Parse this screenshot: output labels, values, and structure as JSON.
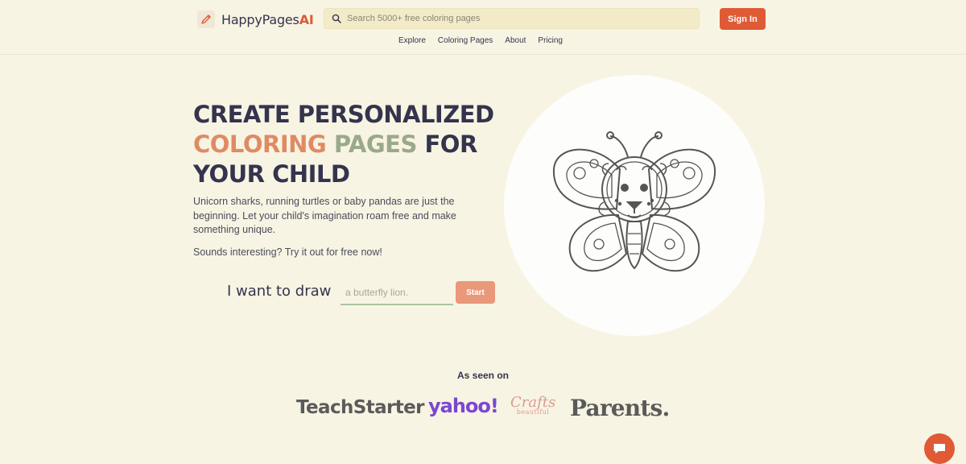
{
  "header": {
    "logo": {
      "text": "HappyPages",
      "accent": "AI",
      "icon": "pencil-icon"
    },
    "search": {
      "placeholder": "Search 5000+ free coloring pages"
    },
    "signin_label": "Sign In",
    "nav": [
      "Explore",
      "Coloring Pages",
      "About",
      "Pricing"
    ]
  },
  "hero": {
    "title_line1": "Create personalized",
    "title_word_colored1": "coloring",
    "title_word_colored2": "pages",
    "title_word_for": "for",
    "title_line3": "your child",
    "lead": "Unicorn sharks, running turtles or baby pandas are just the beginning. Let your child's imagination roam free and make something unique.",
    "sub": "Sounds interesting? Try it out for free now!",
    "draw_label": "I want to draw",
    "draw_placeholder": "a butterfly lion.",
    "start_label": "Start",
    "image": "butterfly-lion-coloring-page"
  },
  "seen_on": {
    "heading": "As seen on",
    "brands": [
      "TeachStarter",
      "yahoo!",
      "Crafts",
      "beautiful",
      "Parents."
    ]
  },
  "chat": {
    "icon": "chat-bubble-icon"
  },
  "colors": {
    "background": "#f8f4e3",
    "accent": "#df5a35",
    "start_button": "#ea987a",
    "title_dark": "#34344e",
    "title_orange": "#e08a64",
    "title_green": "#9aa98a",
    "yahoo_purple": "#7b47d3"
  }
}
